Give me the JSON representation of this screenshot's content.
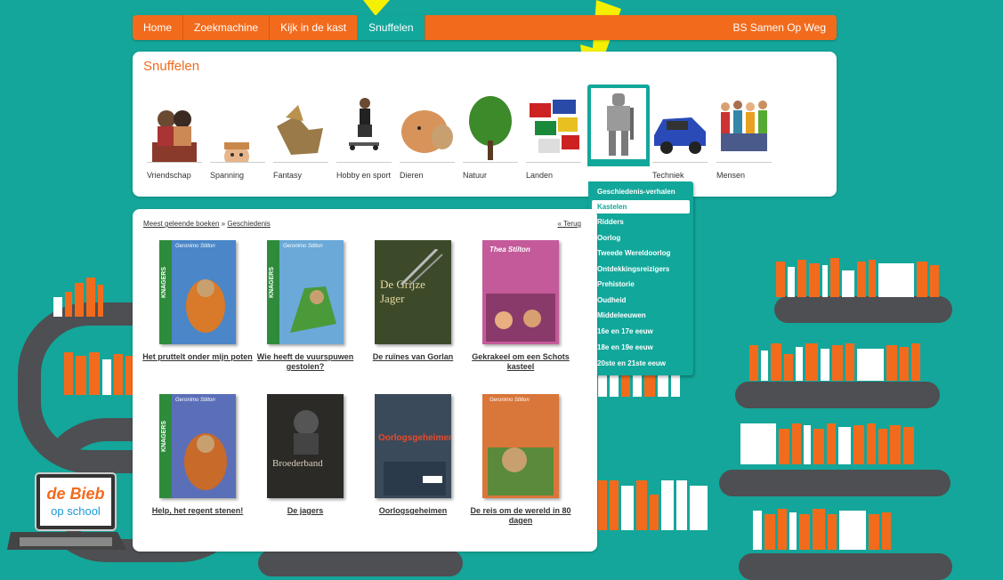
{
  "nav": {
    "items": [
      {
        "label": "Home",
        "active": false
      },
      {
        "label": "Zoekmachine",
        "active": false
      },
      {
        "label": "Kijk in de kast",
        "active": false
      },
      {
        "label": "Snuffelen",
        "active": true
      }
    ],
    "school": "BS Samen Op Weg"
  },
  "snuffelen": {
    "title": "Snuffelen",
    "categories": [
      {
        "label": "Vriendschap",
        "icon": "friends-photo-icon",
        "selected": false
      },
      {
        "label": "Spanning",
        "icon": "peeking-child-photo-icon",
        "selected": false
      },
      {
        "label": "Fantasy",
        "icon": "griffin-photo-icon",
        "selected": false
      },
      {
        "label": "Hobby en sport",
        "icon": "skateboarder-photo-icon",
        "selected": false
      },
      {
        "label": "Dieren",
        "icon": "dog-cat-photo-icon",
        "selected": false
      },
      {
        "label": "Natuur",
        "icon": "tree-photo-icon",
        "selected": false
      },
      {
        "label": "Landen",
        "icon": "flags-photo-icon",
        "selected": false
      },
      {
        "label": "Geschiedenis",
        "icon": "knight-armor-photo-icon",
        "selected": true
      },
      {
        "label": "Techniek",
        "icon": "car-photo-icon",
        "selected": false
      },
      {
        "label": "Mensen",
        "icon": "children-group-photo-icon",
        "selected": false
      }
    ]
  },
  "dropdown": {
    "items": [
      {
        "label": "Geschiedenis-verhalen",
        "active": false
      },
      {
        "label": "Kastelen",
        "active": true
      },
      {
        "label": "Ridders",
        "active": false
      },
      {
        "label": "Oorlog",
        "active": false
      },
      {
        "label": "Tweede Wereldoorlog",
        "active": false
      },
      {
        "label": "Ontdekkingsreizigers",
        "active": false
      },
      {
        "label": "Prehistorie",
        "active": false
      },
      {
        "label": "Oudheid",
        "active": false
      },
      {
        "label": "Middeleeuwen",
        "active": false
      },
      {
        "label": "16e en 17e eeuw",
        "active": false
      },
      {
        "label": "18e en 19e eeuw",
        "active": false
      },
      {
        "label": "20ste en 21ste eeuw",
        "active": false
      }
    ]
  },
  "results": {
    "breadcrumb_root": "Meest geleende boeken",
    "breadcrumb_sep": "»",
    "breadcrumb_current": "Geschiedenis",
    "back_label": "« Terug",
    "books": [
      {
        "title": "Het pruttelt onder mijn poten",
        "cover_text": "Geronimo Stilton",
        "cover_color": "#4a86c8",
        "series": "KNAGERS"
      },
      {
        "title": "Wie heeft de vuurspuwen gestolen?",
        "cover_text": "Geronimo Stilton",
        "cover_color": "#6aa9d8",
        "series": "KNAGERS"
      },
      {
        "title": "De ruïnes van Gorlan",
        "cover_text": "De Grijze Jager",
        "cover_color": "#3c4a2a",
        "series": ""
      },
      {
        "title": "Gekrakeel om een Schots kasteel",
        "cover_text": "Thea Stilton",
        "cover_color": "#c45a9a",
        "series": ""
      },
      {
        "title": "Help, het regent stenen!",
        "cover_text": "Geronimo Stilton",
        "cover_color": "#5b6fb8",
        "series": "KNAGERS"
      },
      {
        "title": "De jagers",
        "cover_text": "Broederband",
        "cover_color": "#2c2a26",
        "series": ""
      },
      {
        "title": "Oorlogsgeheimen",
        "cover_text": "Oorlogsgeheimen",
        "cover_color": "#3a4a5a",
        "series": ""
      },
      {
        "title": "De reis om de wereld in 80 dagen",
        "cover_text": "Geronimo Stilton",
        "cover_color": "#d9763a",
        "series": ""
      }
    ]
  },
  "logo": {
    "line1": "de Bieb",
    "line2": "op school"
  },
  "colors": {
    "orange": "#f26b1d",
    "teal": "#12a79b",
    "arrow": "#f5f000"
  }
}
